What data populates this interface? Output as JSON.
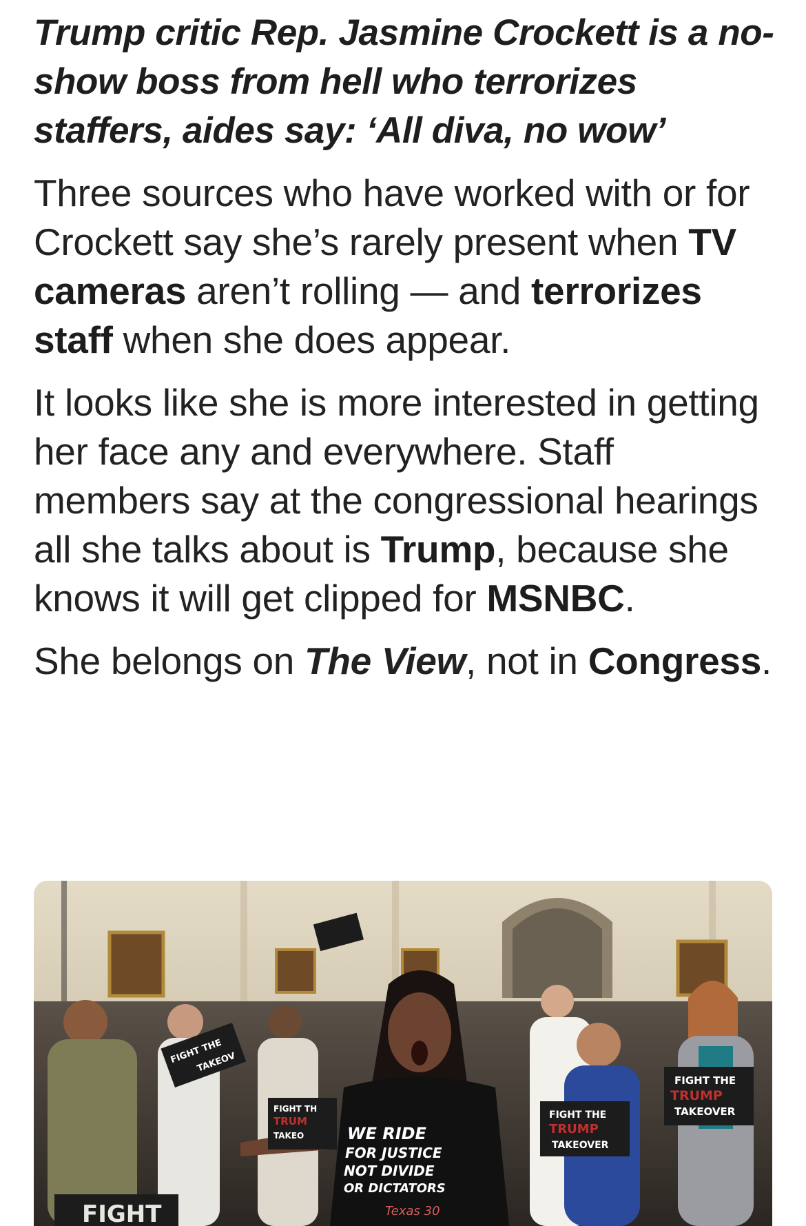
{
  "article": {
    "headline": "Trump critic Rep. Jasmine Crockett is a no-show boss from hell who terrorizes staffers, aides say: ‘All diva, no wow’",
    "p1": {
      "t1": "Three sources who have worked with or for Crockett say she’s rarely present when ",
      "b1": "TV cameras",
      "t2": " aren’t rolling — and ",
      "b2": "terrorizes staff",
      "t3": " when she does appear."
    },
    "p2": {
      "t1": "It looks like she is more interested in getting her face any and everywhere. Staff members say at the congressional hearings all she talks about is ",
      "b1": "Trump",
      "t2": ", because she knows it will get clipped for ",
      "b2": "MSNBC",
      "t3": "."
    },
    "p3": {
      "t1": "She belongs on ",
      "i1": "The View",
      "t2": ", not in ",
      "b1": "Congress",
      "t3": "."
    }
  },
  "photo": {
    "signs": {
      "line1": "FIGHT THE",
      "line2": "TRUMP",
      "line3": "TAKEOVER",
      "partial_left_1": "FIGHT THE",
      "partial_left_2": "TAKEOV",
      "partial_mid_1": "FIGHT TH",
      "partial_mid_2": "TRUM",
      "partial_mid_3": "TAKEO",
      "bottom_left": "FIGHT"
    },
    "shirt": {
      "line1": "WE RIDE",
      "line2": "FOR JUSTICE",
      "line3": "NOT DIVIDE",
      "line4": "OR DICTATORS",
      "sig": "Texas 30"
    },
    "colors": {
      "wall": "#d9cfb9",
      "sign": "#1c1c1c",
      "trump_red": "#c0302c",
      "shirt": "#111111"
    }
  }
}
